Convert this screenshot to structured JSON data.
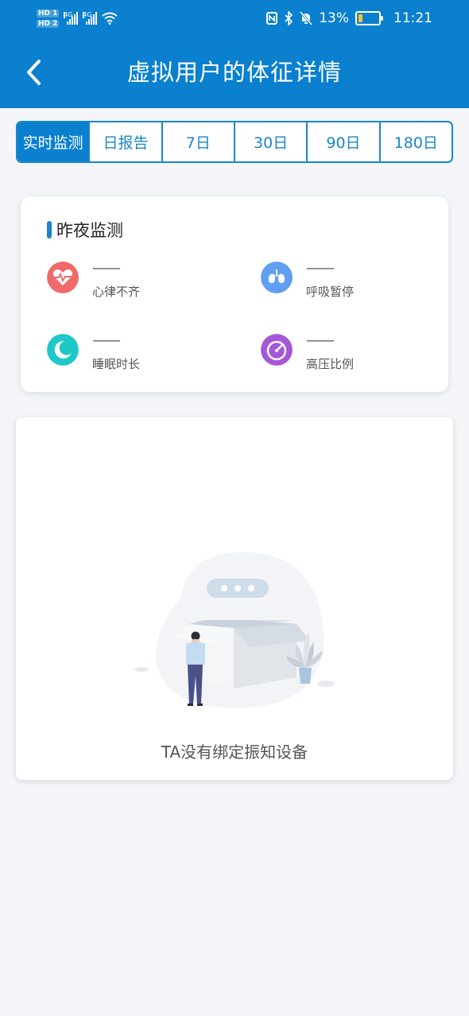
{
  "status_bar": {
    "hd1": "HD 1",
    "hd2": "HD 2",
    "net1": "4G",
    "net2": "4G",
    "battery": "13%",
    "time": "11:21"
  },
  "header": {
    "title": "虚拟用户的体征详情"
  },
  "tabs": [
    {
      "label": "实时监测",
      "active": true
    },
    {
      "label": "日报告"
    },
    {
      "label": "7日"
    },
    {
      "label": "30日"
    },
    {
      "label": "90日"
    },
    {
      "label": "180日"
    }
  ],
  "last_night": {
    "title": "昨夜监测",
    "metrics": [
      {
        "value": "——",
        "label": "心律不齐",
        "icon": "heart-rate-icon",
        "color": "#f06a6a"
      },
      {
        "value": "——",
        "label": "呼吸暂停",
        "icon": "lungs-icon",
        "color": "#5e9ff2"
      },
      {
        "value": "——",
        "label": "睡眠时长",
        "icon": "moon-sleep-icon",
        "color": "#1fc8c8"
      },
      {
        "value": "——",
        "label": "高压比例",
        "icon": "gauge-icon",
        "color": "#a557d9"
      }
    ]
  },
  "empty_state": {
    "message": "TA没有绑定振知设备"
  },
  "colors": {
    "primary": "#0a80cf",
    "background": "#f3f5f9"
  }
}
